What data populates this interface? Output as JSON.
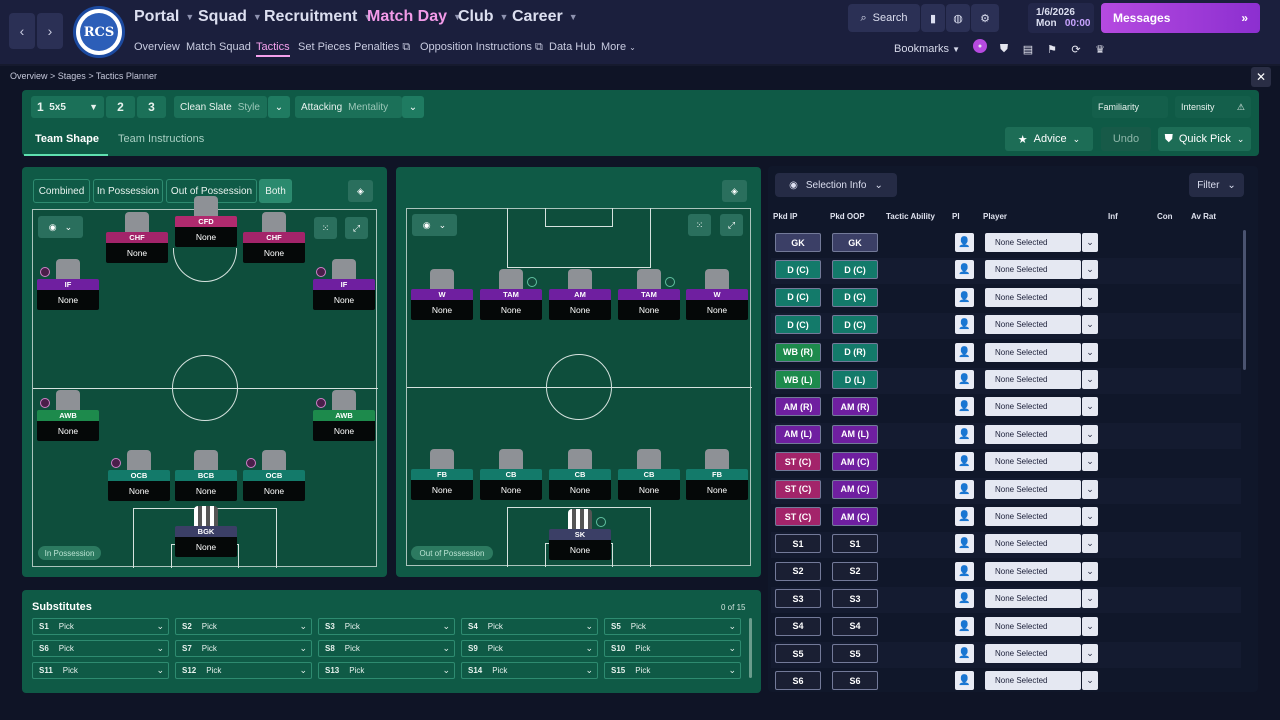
{
  "topnav": {
    "items": [
      {
        "label": "Portal"
      },
      {
        "label": "Squad"
      },
      {
        "label": "Recruitment"
      },
      {
        "label": "Match Day"
      },
      {
        "label": "Club"
      },
      {
        "label": "Career"
      }
    ],
    "subitems": [
      {
        "label": "Overview"
      },
      {
        "label": "Match Squad"
      },
      {
        "label": "Tactics"
      },
      {
        "label": "Set Pieces"
      },
      {
        "label": "Penalties"
      },
      {
        "label": "Opposition Instructions"
      },
      {
        "label": "Data Hub"
      },
      {
        "label": "More"
      }
    ],
    "search_label": "Search",
    "date": "1/6/2026",
    "day": "Mon",
    "time": "00:00",
    "messages_label": "Messages",
    "bookmarks_label": "Bookmarks",
    "crest_text": "RCS"
  },
  "breadcrumb": [
    "Overview",
    "Stages",
    "Tactics Planner"
  ],
  "tactics": {
    "slot1_number": "1",
    "slot1_formation": "5x5",
    "slot2": "2",
    "slot3": "3",
    "style_value": "Clean Slate",
    "style_label": "Style",
    "mentality_value": "Attacking",
    "mentality_label": "Mentality",
    "familiarity_label": "Familiarity",
    "intensity_label": "Intensity",
    "tab_team_shape": "Team Shape",
    "tab_team_instructions": "Team Instructions",
    "advice_label": "Advice",
    "undo_label": "Undo",
    "quickpick_label": "Quick Pick"
  },
  "phase_buttons": [
    "Combined",
    "In Possession",
    "Out of Possession",
    "Both"
  ],
  "in_possession": {
    "status": "In Possession",
    "players": [
      {
        "role": "CFD",
        "name": "None",
        "color": "#b02a6e"
      },
      {
        "role": "CHF",
        "name": "None",
        "color": "#a3246a"
      },
      {
        "role": "CHF",
        "name": "None",
        "color": "#a3246a"
      },
      {
        "role": "IF",
        "name": "None",
        "color": "#6f1fa0"
      },
      {
        "role": "IF",
        "name": "None",
        "color": "#6f1fa0"
      },
      {
        "role": "AWB",
        "name": "None",
        "color": "#1d8a4c"
      },
      {
        "role": "AWB",
        "name": "None",
        "color": "#1d8a4c"
      },
      {
        "role": "OCB",
        "name": "None",
        "color": "#137a6a"
      },
      {
        "role": "BCB",
        "name": "None",
        "color": "#137a6a"
      },
      {
        "role": "OCB",
        "name": "None",
        "color": "#137a6a"
      },
      {
        "role": "BGK",
        "name": "None",
        "color": "#3b3f66"
      }
    ]
  },
  "out_of_possession": {
    "status": "Out of Possession",
    "players": [
      {
        "role": "W",
        "name": "None",
        "color": "#6f1fa0"
      },
      {
        "role": "TAM",
        "name": "None",
        "color": "#6f1fa0"
      },
      {
        "role": "AM",
        "name": "None",
        "color": "#6f1fa0"
      },
      {
        "role": "TAM",
        "name": "None",
        "color": "#6f1fa0"
      },
      {
        "role": "W",
        "name": "None",
        "color": "#6f1fa0"
      },
      {
        "role": "FB",
        "name": "None",
        "color": "#137a6a"
      },
      {
        "role": "CB",
        "name": "None",
        "color": "#137a6a"
      },
      {
        "role": "CB",
        "name": "None",
        "color": "#137a6a"
      },
      {
        "role": "CB",
        "name": "None",
        "color": "#137a6a"
      },
      {
        "role": "FB",
        "name": "None",
        "color": "#137a6a"
      },
      {
        "role": "SK",
        "name": "None",
        "color": "#3b3f66"
      }
    ]
  },
  "substitutes": {
    "title": "Substitutes",
    "count": "0 of 15",
    "slots": [
      {
        "id": "S1",
        "value": "Pick"
      },
      {
        "id": "S2",
        "value": "Pick"
      },
      {
        "id": "S3",
        "value": "Pick"
      },
      {
        "id": "S4",
        "value": "Pick"
      },
      {
        "id": "S5",
        "value": "Pick"
      },
      {
        "id": "S6",
        "value": "Pick"
      },
      {
        "id": "S7",
        "value": "Pick"
      },
      {
        "id": "S8",
        "value": "Pick"
      },
      {
        "id": "S9",
        "value": "Pick"
      },
      {
        "id": "S10",
        "value": "Pick"
      },
      {
        "id": "S11",
        "value": "Pick"
      },
      {
        "id": "S12",
        "value": "Pick"
      },
      {
        "id": "S13",
        "value": "Pick"
      },
      {
        "id": "S14",
        "value": "Pick"
      },
      {
        "id": "S15",
        "value": "Pick"
      }
    ]
  },
  "selection": {
    "info_label": "Selection Info",
    "filter_label": "Filter",
    "headers": [
      "Pkd IP",
      "Pkd OOP",
      "Tactic Ability",
      "PI",
      "Player",
      "Inf",
      "Con",
      "Av Rat"
    ],
    "rows": [
      {
        "ip": "GK",
        "oop": "GK",
        "ipc": "#3b3f66",
        "oopc": "#3b3f66",
        "player": "None Selected"
      },
      {
        "ip": "D (C)",
        "oop": "D (C)",
        "ipc": "#137a6a",
        "oopc": "#137a6a",
        "player": "None Selected"
      },
      {
        "ip": "D (C)",
        "oop": "D (C)",
        "ipc": "#137a6a",
        "oopc": "#137a6a",
        "player": "None Selected"
      },
      {
        "ip": "D (C)",
        "oop": "D (C)",
        "ipc": "#137a6a",
        "oopc": "#137a6a",
        "player": "None Selected"
      },
      {
        "ip": "WB (R)",
        "oop": "D (R)",
        "ipc": "#1d8a4c",
        "oopc": "#137a6a",
        "player": "None Selected"
      },
      {
        "ip": "WB (L)",
        "oop": "D (L)",
        "ipc": "#1d8a4c",
        "oopc": "#137a6a",
        "player": "None Selected"
      },
      {
        "ip": "AM (R)",
        "oop": "AM (R)",
        "ipc": "#6f1fa0",
        "oopc": "#6f1fa0",
        "player": "None Selected"
      },
      {
        "ip": "AM (L)",
        "oop": "AM (L)",
        "ipc": "#6f1fa0",
        "oopc": "#6f1fa0",
        "player": "None Selected"
      },
      {
        "ip": "ST (C)",
        "oop": "AM (C)",
        "ipc": "#a3246a",
        "oopc": "#6f1fa0",
        "player": "None Selected"
      },
      {
        "ip": "ST (C)",
        "oop": "AM (C)",
        "ipc": "#a3246a",
        "oopc": "#6f1fa0",
        "player": "None Selected"
      },
      {
        "ip": "ST (C)",
        "oop": "AM (C)",
        "ipc": "#a3246a",
        "oopc": "#6f1fa0",
        "player": "None Selected"
      },
      {
        "ip": "S1",
        "oop": "S1",
        "ipc": "#1a1f33",
        "oopc": "#1a1f33",
        "player": "None Selected"
      },
      {
        "ip": "S2",
        "oop": "S2",
        "ipc": "#1a1f33",
        "oopc": "#1a1f33",
        "player": "None Selected"
      },
      {
        "ip": "S3",
        "oop": "S3",
        "ipc": "#1a1f33",
        "oopc": "#1a1f33",
        "player": "None Selected"
      },
      {
        "ip": "S4",
        "oop": "S4",
        "ipc": "#1a1f33",
        "oopc": "#1a1f33",
        "player": "None Selected"
      },
      {
        "ip": "S5",
        "oop": "S5",
        "ipc": "#1a1f33",
        "oopc": "#1a1f33",
        "player": "None Selected"
      },
      {
        "ip": "S6",
        "oop": "S6",
        "ipc": "#1a1f33",
        "oopc": "#1a1f33",
        "player": "None Selected"
      }
    ]
  }
}
